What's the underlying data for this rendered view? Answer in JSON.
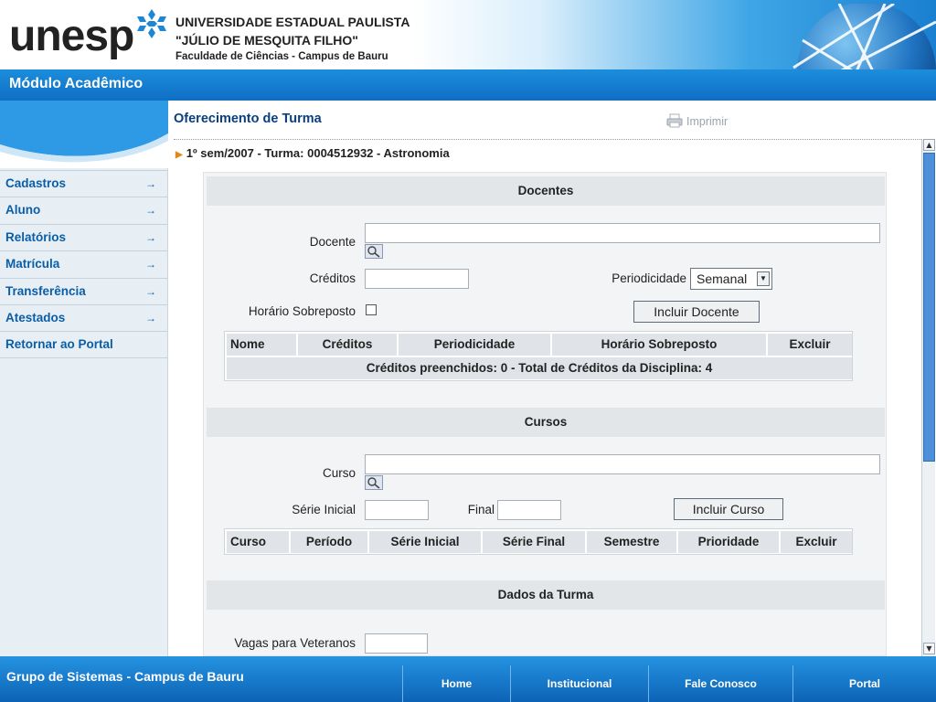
{
  "header": {
    "logo_text": "unesp",
    "univ_line1": "UNIVERSIDADE ESTADUAL PAULISTA",
    "univ_line2": "\"JÚLIO DE MESQUITA FILHO\"",
    "univ_line3": "Faculdade de Ciências - Campus de Bauru"
  },
  "module": {
    "title": "Módulo Acadêmico"
  },
  "sidebar": {
    "items": [
      {
        "label": "Cadastros",
        "arrow": "→"
      },
      {
        "label": "Aluno",
        "arrow": "→"
      },
      {
        "label": "Relatórios",
        "arrow": "→"
      },
      {
        "label": "Matrícula",
        "arrow": "→"
      },
      {
        "label": "Transferência",
        "arrow": "→"
      },
      {
        "label": "Atestados",
        "arrow": "→"
      },
      {
        "label": "Retornar ao Portal",
        "arrow": ""
      }
    ]
  },
  "main": {
    "title": "Oferecimento de Turma",
    "print_label": "Imprimir",
    "breadcrumb": "1º sem/2007 - Turma: 0004512932 - Astronomia"
  },
  "docentes": {
    "section_title": "Docentes",
    "docente_label": "Docente",
    "docente_value": "",
    "creditos_label": "Créditos",
    "creditos_value": "",
    "periodicidade_label": "Periodicidade",
    "periodicidade_value": "Semanal",
    "horario_label": "Horário Sobreposto",
    "horario_checked": false,
    "incluir_button": "Incluir Docente",
    "columns": [
      "Nome",
      "Créditos",
      "Periodicidade",
      "Horário Sobreposto",
      "Excluir"
    ],
    "summary": "Créditos preenchidos: 0 - Total de Créditos da Disciplina: 4"
  },
  "cursos": {
    "section_title": "Cursos",
    "curso_label": "Curso",
    "curso_value": "",
    "serie_inicial_label": "Série Inicial",
    "serie_inicial_value": "",
    "final_label": "Final",
    "final_value": "",
    "incluir_button": "Incluir Curso",
    "columns": [
      "Curso",
      "Período",
      "Série Inicial",
      "Série Final",
      "Semestre",
      "Prioridade",
      "Excluir"
    ]
  },
  "dados_turma": {
    "section_title": "Dados da Turma",
    "vagas_label": "Vagas para Veteranos",
    "vagas_value": ""
  },
  "footer": {
    "text": "Grupo de Sistemas - Campus de Bauru",
    "nav": [
      "Home",
      "Institucional",
      "Fale Conosco",
      "Portal"
    ]
  },
  "colors": {
    "brand_blue": "#0f6fc4",
    "link_blue": "#0a5ea8",
    "title_blue": "#0a3f7f",
    "accent_orange": "#e08a16"
  }
}
